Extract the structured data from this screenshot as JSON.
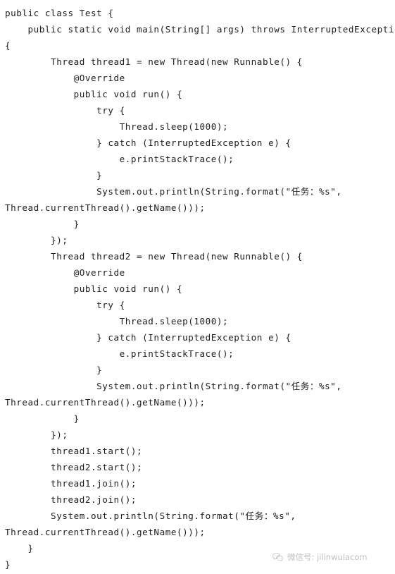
{
  "document": {
    "type": "code-listing",
    "language": "java",
    "background_color": "#ffffff",
    "text_color": "#1d1d1d"
  },
  "code": {
    "lines": [
      "public class Test {",
      "    public static void main(String[] args) throws InterruptedException",
      "{",
      "        Thread thread1 = new Thread(new Runnable() {",
      "            @Override",
      "            public void run() {",
      "                try {",
      "                    Thread.sleep(1000);",
      "                } catch (InterruptedException e) {",
      "                    e.printStackTrace();",
      "                }",
      "                System.out.println(String.format(\"任务：%s\",",
      "Thread.currentThread().getName()));",
      "            }",
      "        });",
      "        Thread thread2 = new Thread(new Runnable() {",
      "            @Override",
      "            public void run() {",
      "                try {",
      "                    Thread.sleep(1000);",
      "                } catch (InterruptedException e) {",
      "                    e.printStackTrace();",
      "                }",
      "                System.out.println(String.format(\"任务：%s\",",
      "Thread.currentThread().getName()));",
      "            }",
      "        });",
      "        thread1.start();",
      "        thread2.start();",
      "        thread1.join();",
      "        thread2.join();",
      "        System.out.println(String.format(\"任务：%s\",",
      "Thread.currentThread().getName()));",
      "    }",
      "}"
    ]
  },
  "watermark": {
    "icon": "wechat-icon",
    "text": "微信号: jilinwulacom"
  }
}
